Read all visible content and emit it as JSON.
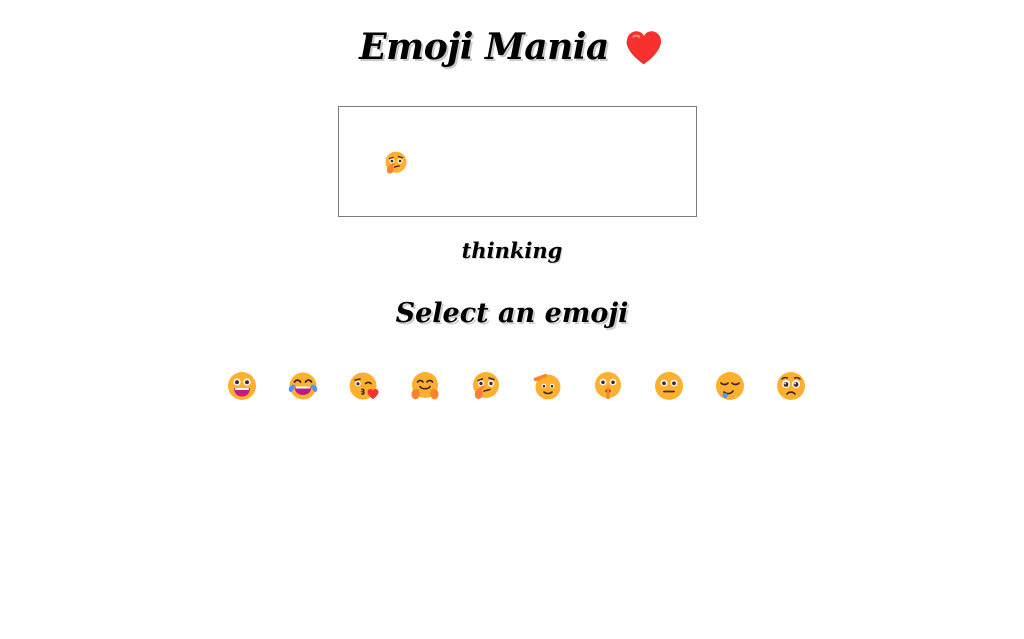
{
  "header": {
    "title": "Emoji Mania",
    "title_icon": "red-heart-icon"
  },
  "display": {
    "selected_emoji": "thinking-face-icon",
    "meaning": "thinking"
  },
  "picker": {
    "heading": "Select an emoji",
    "emojis": [
      {
        "icon": "grinning-face-icon"
      },
      {
        "icon": "tears-of-joy-face-icon"
      },
      {
        "icon": "kissing-face-icon"
      },
      {
        "icon": "hugging-face-icon"
      },
      {
        "icon": "thinking-face-icon"
      },
      {
        "icon": "saluting-face-icon"
      },
      {
        "icon": "shushing-face-icon"
      },
      {
        "icon": "neutral-face-icon"
      },
      {
        "icon": "sleepy-face-icon"
      },
      {
        "icon": "worried-face-icon"
      }
    ]
  },
  "colors": {
    "emoji_yellow": "#FFB02E",
    "emoji_dark": "#402A32",
    "heart_red": "#F8312F",
    "input_border": "#7A7A7A"
  }
}
